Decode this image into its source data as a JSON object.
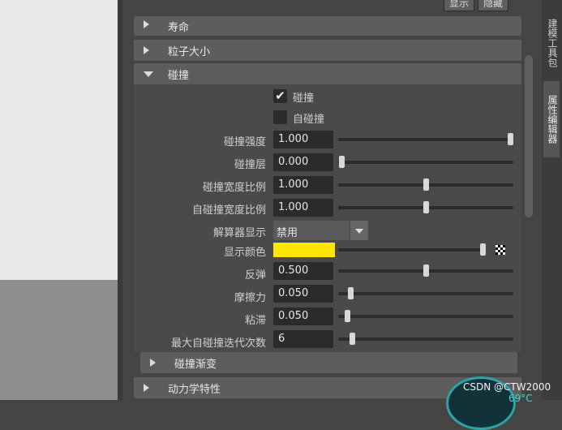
{
  "top_buttons": {
    "show": "显示",
    "hide": "隐藏"
  },
  "sections": {
    "lifetime": "寿命",
    "particle_size": "粒子大小",
    "collision": "碰撞",
    "collision_ramp": "碰撞渐变",
    "dynamics": "动力学特性"
  },
  "collision": {
    "enable_label": "碰撞",
    "enable_checked": true,
    "self_label": "自碰撞",
    "self_checked": false,
    "strength": {
      "label": "碰撞强度",
      "value": "1.000",
      "fraction": 1.0
    },
    "layer": {
      "label": "碰撞层",
      "value": "0.000",
      "fraction": 0.0
    },
    "width_scale": {
      "label": "碰撞宽度比例",
      "value": "1.000",
      "fraction": 0.5
    },
    "self_width_scale": {
      "label": "自碰撞宽度比例",
      "value": "1.000",
      "fraction": 0.5
    },
    "solver_display": {
      "label": "解算器显示",
      "value": "禁用"
    },
    "display_color": {
      "label": "显示颜色",
      "color": "#ffe600",
      "fraction": 1.0
    },
    "bounce": {
      "label": "反弹",
      "value": "0.500",
      "fraction": 0.5
    },
    "friction": {
      "label": "摩擦力",
      "value": "0.050",
      "fraction": 0.05
    },
    "stickiness": {
      "label": "粘滞",
      "value": "0.050",
      "fraction": 0.03
    },
    "max_self_iterations": {
      "label": "最大自碰撞迭代次数",
      "value": "6",
      "fraction": 0.06
    }
  },
  "side_tabs": {
    "modeling_toolkit": "建模工具包",
    "attribute_editor": "属性编辑器"
  },
  "overlay": {
    "watermark": "CSDN @CTW2000",
    "temperature": "69°C"
  }
}
